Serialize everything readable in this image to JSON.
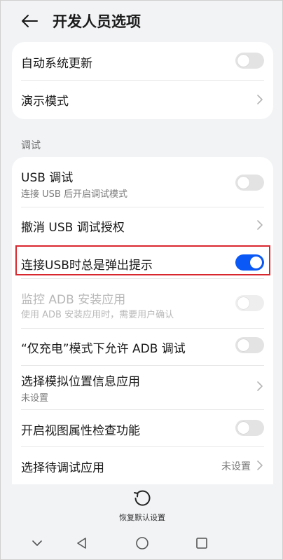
{
  "header": {
    "title": "开发人员选项"
  },
  "group1": {
    "auto_update": {
      "label": "自动系统更新",
      "enabled": false
    },
    "demo_mode": {
      "label": "演示模式"
    }
  },
  "section": {
    "debug_label": "调试"
  },
  "group2": {
    "usb_debug": {
      "label": "USB 调试",
      "sub": "连接 USB 后开启调试模式",
      "enabled": false
    },
    "revoke_usb": {
      "label": "撤消 USB 调试授权"
    },
    "usb_popup": {
      "label": "连接USB时总是弹出提示",
      "enabled": true
    },
    "monitor_adb": {
      "label": "监控 ADB 安装应用",
      "sub": "使用 ADB 安装应用时，需要用户确认",
      "enabled": false,
      "disabled": true
    },
    "charge_adb": {
      "label": "“仅充电”模式下允许 ADB 调试",
      "enabled": false
    },
    "mock_location": {
      "label": "选择模拟位置信息应用",
      "sub": "未设置"
    },
    "view_inspect": {
      "label": "开启视图属性检查功能",
      "enabled": false
    },
    "debug_app": {
      "label": "选择待调试应用",
      "value": "未设置"
    }
  },
  "footer": {
    "reset_label": "恢复默认设置"
  },
  "colors": {
    "accent": "#0a59f7",
    "highlight": "#d9272e"
  }
}
